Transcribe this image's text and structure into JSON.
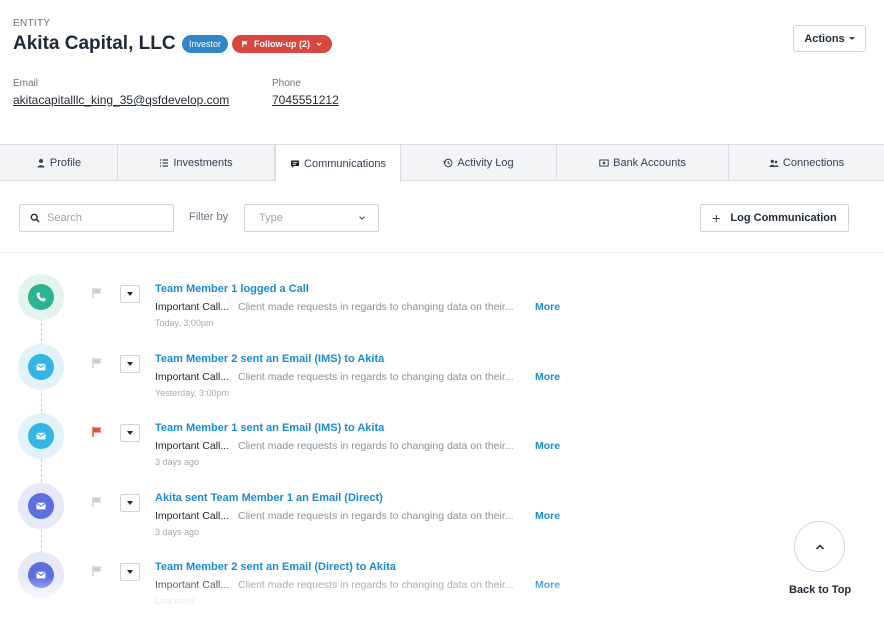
{
  "entity": {
    "label": "ENTITY",
    "name": "Akita Capital, LLC",
    "type_badge": "Investor",
    "followup_badge": "Follow-up (2)"
  },
  "actions_label": "Actions",
  "contact": {
    "email_label": "Email",
    "email_value": "akitacapitalllc_king_35@qsfdevelop.com",
    "phone_label": "Phone",
    "phone_value": "7045551212"
  },
  "tabs": [
    {
      "label": "Profile",
      "icon": "person-icon"
    },
    {
      "label": "Investments",
      "icon": "list-icon"
    },
    {
      "label": "Communications",
      "icon": "chat-icon",
      "active": true
    },
    {
      "label": "Activity Log",
      "icon": "history-icon"
    },
    {
      "label": "Bank Accounts",
      "icon": "bank-icon"
    },
    {
      "label": "Connections",
      "icon": "users-icon"
    }
  ],
  "toolbar": {
    "search_placeholder": "Search",
    "filter_label": "Filter by",
    "type_placeholder": "Type",
    "log_button": "Log Communication"
  },
  "communications": [
    {
      "title": "Team Member 1 logged a Call",
      "subject": "Important Call...",
      "snippet": "Client made requests in regards to changing data on their...",
      "more": "More",
      "time": "Today, 3:00pm",
      "kind": "call",
      "flagged": false
    },
    {
      "title": "Team Member 2 sent an Email (IMS) to Akita",
      "subject": "Important Call...",
      "snippet": "Client made requests in regards to changing data on their...",
      "more": "More",
      "time": "Yesterday, 3:00pm",
      "kind": "email-ims",
      "flagged": false
    },
    {
      "title": "Team Member 1 sent an Email (IMS) to Akita",
      "subject": "Important Call...",
      "snippet": "Client made requests in regards to changing data on their...",
      "more": "More",
      "time": "3 days ago",
      "kind": "email-ims",
      "flagged": true
    },
    {
      "title": "Akita sent Team Member 1 an Email (Direct)",
      "subject": "Important Call...",
      "snippet": "Client made requests in regards to changing data on their...",
      "more": "More",
      "time": "3 days ago",
      "kind": "email-direct",
      "flagged": false
    },
    {
      "title": "Team Member 2 sent an Email (Direct) to Akita",
      "subject": "Important Call...",
      "snippet": "Client made requests in regards to changing data on their...",
      "more": "More",
      "time": "Last week",
      "kind": "email-direct",
      "flagged": false
    }
  ],
  "back_to_top_label": "Back to Top",
  "colors": {
    "accent_blue": "#1a8ccf",
    "investor_badge": "#2f86c8",
    "followup_badge": "#d9473f",
    "call_icon": "#2bb48f",
    "email_ims_icon": "#35b5e5",
    "email_direct_icon": "#5b6fe0",
    "flag_active": "#e5483f",
    "flag_inactive": "#c9ced4"
  }
}
